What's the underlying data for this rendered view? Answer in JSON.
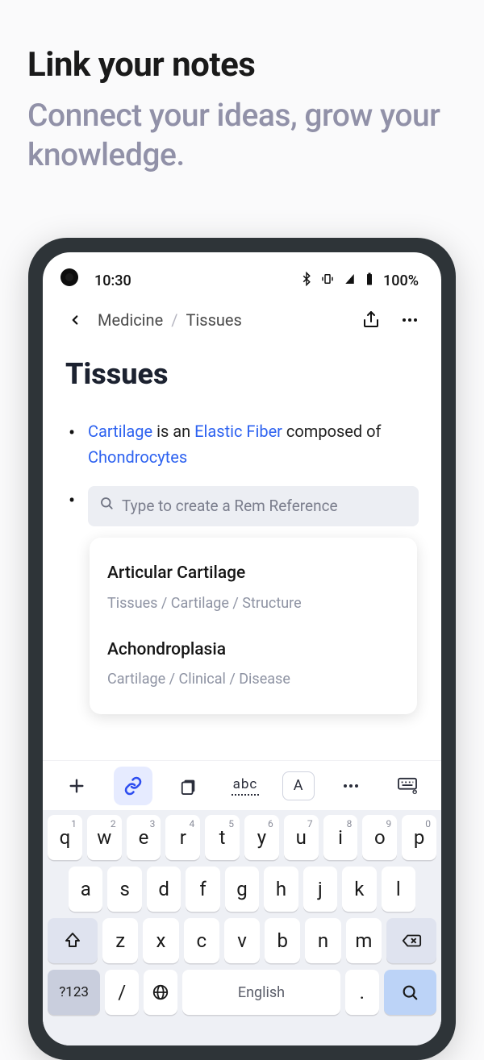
{
  "promo": {
    "title": "Link your notes",
    "subtitle": "Connect your ideas, grow your knowledge."
  },
  "status": {
    "time": "10:30",
    "battery": "100%"
  },
  "nav": {
    "crumb1": "Medicine",
    "sep": "/",
    "crumb2": "Tissues"
  },
  "page": {
    "title": "Tissues"
  },
  "note": {
    "t1": "Cartilage",
    "t2": " is an ",
    "t3": "Elastic Fiber",
    "t4": " composed of ",
    "t5": "Chondrocytes",
    "placeholder": "Type to create a Rem Reference"
  },
  "suggestions": [
    {
      "title": "Articular Cartilage",
      "path": "Tissues /  Cartilage /  Structure"
    },
    {
      "title": "Achondroplasia",
      "path": "Cartilage /  Clinical /  Disease"
    }
  ],
  "toolbar": {
    "abc": "abc",
    "A": "A"
  },
  "keyboard": {
    "row1": [
      "q",
      "w",
      "e",
      "r",
      "t",
      "y",
      "u",
      "i",
      "o",
      "p"
    ],
    "row1sup": [
      "1",
      "2",
      "3",
      "4",
      "5",
      "6",
      "7",
      "8",
      "9",
      "0"
    ],
    "row2": [
      "a",
      "s",
      "d",
      "f",
      "g",
      "h",
      "j",
      "k",
      "l"
    ],
    "row3": [
      "z",
      "x",
      "c",
      "v",
      "b",
      "n",
      "m"
    ],
    "sym": "?123",
    "slash": "/",
    "space": "English",
    "dot": "."
  }
}
